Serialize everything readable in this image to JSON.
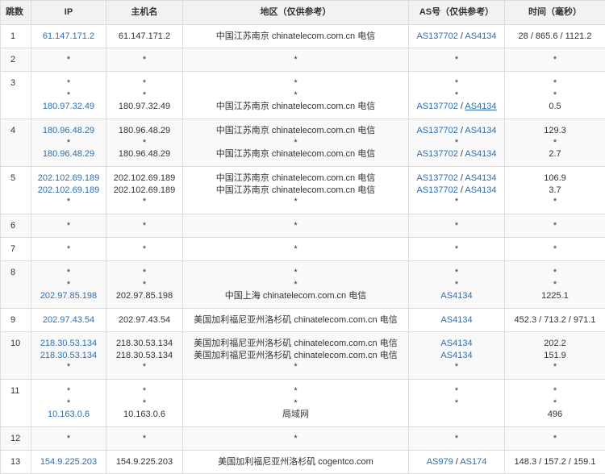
{
  "colors": {
    "link": "#2b6fb3",
    "header_bg": "#f2f2f2",
    "alt_row_bg": "#f9f9f9",
    "border": "#dddddd",
    "text": "#333333"
  },
  "headers": {
    "hop": "跳数",
    "ip": "IP",
    "host": "主机名",
    "region": "地区（仅供参考）",
    "as": "AS号（仅供参考）",
    "time": "时间（毫秒）"
  },
  "rows": [
    {
      "hop": "1",
      "lines": [
        {
          "ip": "61.147.171.2",
          "host": "61.147.171.2",
          "region": "中国江苏南京 chinatelecom.com.cn 电信",
          "as": [
            "AS137702",
            "AS4134"
          ],
          "time": "28 / 865.6 / 1121.2"
        }
      ]
    },
    {
      "hop": "2",
      "lines": [
        {
          "ip": "*",
          "host": "*",
          "region": "*",
          "as": "*",
          "time": "*"
        }
      ]
    },
    {
      "hop": "3",
      "lines": [
        {
          "ip": "*",
          "host": "*",
          "region": "*",
          "as": "*",
          "time": "*"
        },
        {
          "ip": "*",
          "host": "*",
          "region": "*",
          "as": "*",
          "time": "*"
        },
        {
          "ip": "180.97.32.49",
          "host": "180.97.32.49",
          "region": "中国江苏南京 chinatelecom.com.cn 电信",
          "as": [
            "AS137702",
            "AS4134"
          ],
          "as_underline": [
            false,
            true
          ],
          "time": "0.5"
        }
      ]
    },
    {
      "hop": "4",
      "lines": [
        {
          "ip": "180.96.48.29",
          "host": "180.96.48.29",
          "region": "中国江苏南京 chinatelecom.com.cn 电信",
          "as": [
            "AS137702",
            "AS4134"
          ],
          "time": "129.3"
        },
        {
          "ip": "*",
          "host": "*",
          "region": "*",
          "as": "*",
          "time": "*"
        },
        {
          "ip": "180.96.48.29",
          "host": "180.96.48.29",
          "region": "中国江苏南京 chinatelecom.com.cn 电信",
          "as": [
            "AS137702",
            "AS4134"
          ],
          "time": "2.7"
        }
      ]
    },
    {
      "hop": "5",
      "lines": [
        {
          "ip": "202.102.69.189",
          "host": "202.102.69.189",
          "region": "中国江苏南京 chinatelecom.com.cn 电信",
          "as": [
            "AS137702",
            "AS4134"
          ],
          "time": "106.9"
        },
        {
          "ip": "202.102.69.189",
          "host": "202.102.69.189",
          "region": "中国江苏南京 chinatelecom.com.cn 电信",
          "as": [
            "AS137702",
            "AS4134"
          ],
          "time": "3.7"
        },
        {
          "ip": "*",
          "host": "*",
          "region": "*",
          "as": "*",
          "time": "*"
        }
      ]
    },
    {
      "hop": "6",
      "lines": [
        {
          "ip": "*",
          "host": "*",
          "region": "*",
          "as": "*",
          "time": "*"
        }
      ]
    },
    {
      "hop": "7",
      "lines": [
        {
          "ip": "*",
          "host": "*",
          "region": "*",
          "as": "*",
          "time": "*"
        }
      ]
    },
    {
      "hop": "8",
      "lines": [
        {
          "ip": "*",
          "host": "*",
          "region": "*",
          "as": "*",
          "time": "*"
        },
        {
          "ip": "*",
          "host": "*",
          "region": "*",
          "as": "*",
          "time": "*"
        },
        {
          "ip": "202.97.85.198",
          "host": "202.97.85.198",
          "region": "中国上海 chinatelecom.com.cn 电信",
          "as": [
            "AS4134"
          ],
          "time": "1225.1"
        }
      ]
    },
    {
      "hop": "9",
      "lines": [
        {
          "ip": "202.97.43.54",
          "host": "202.97.43.54",
          "region": "美国加利福尼亚州洛杉矶 chinatelecom.com.cn 电信",
          "as": [
            "AS4134"
          ],
          "time": "452.3 / 713.2 / 971.1"
        }
      ]
    },
    {
      "hop": "10",
      "lines": [
        {
          "ip": "218.30.53.134",
          "host": "218.30.53.134",
          "region": "美国加利福尼亚州洛杉矶 chinatelecom.com.cn 电信",
          "as": [
            "AS4134"
          ],
          "time": "202.2"
        },
        {
          "ip": "218.30.53.134",
          "host": "218.30.53.134",
          "region": "美国加利福尼亚州洛杉矶 chinatelecom.com.cn 电信",
          "as": [
            "AS4134"
          ],
          "time": "151.9"
        },
        {
          "ip": "*",
          "host": "*",
          "region": "*",
          "as": "*",
          "time": "*"
        }
      ]
    },
    {
      "hop": "11",
      "lines": [
        {
          "ip": "*",
          "host": "*",
          "region": "*",
          "as": "*",
          "time": "*"
        },
        {
          "ip": "*",
          "host": "*",
          "region": "*",
          "as": "*",
          "time": "*"
        },
        {
          "ip": "10.163.0.6",
          "host": "10.163.0.6",
          "region": "局域网",
          "as": "",
          "time": "496"
        }
      ]
    },
    {
      "hop": "12",
      "lines": [
        {
          "ip": "*",
          "host": "*",
          "region": "*",
          "as": "*",
          "time": "*"
        }
      ]
    },
    {
      "hop": "13",
      "lines": [
        {
          "ip": "154.9.225.203",
          "host": "154.9.225.203",
          "region": "美国加利福尼亚州洛杉矶 cogentco.com",
          "as": [
            "AS979",
            "AS174"
          ],
          "time": "148.3 / 157.2 / 159.1"
        }
      ]
    }
  ]
}
